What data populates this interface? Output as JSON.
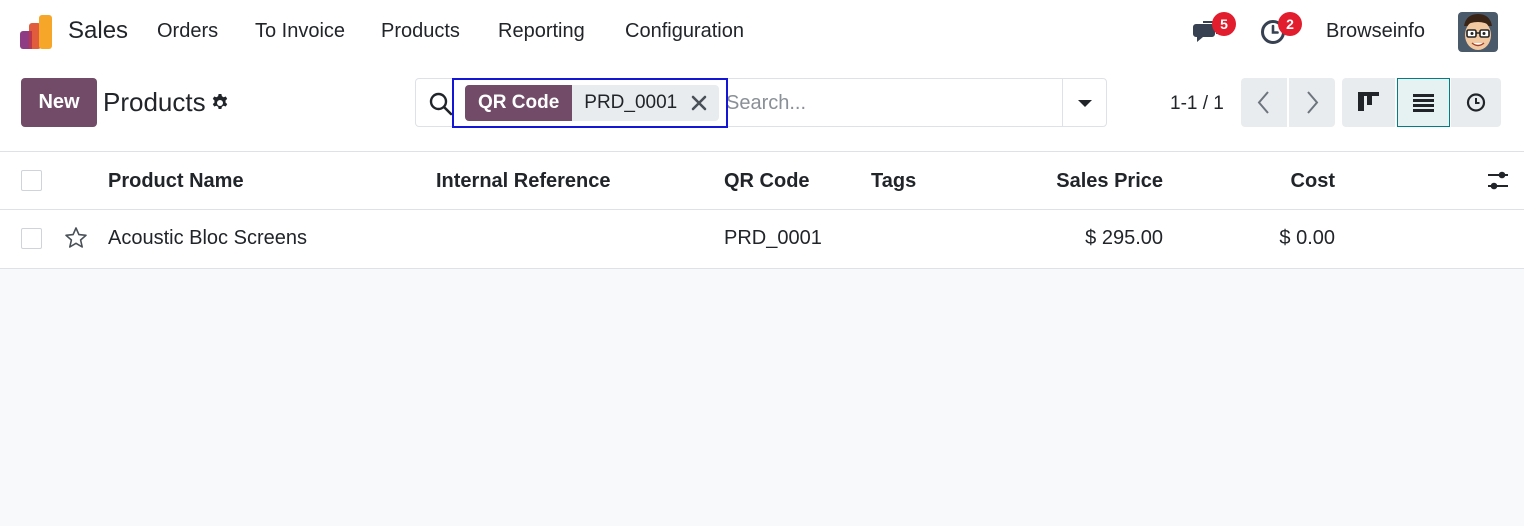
{
  "navbar": {
    "app_name": "Sales",
    "menus": [
      "Orders",
      "To Invoice",
      "Products",
      "Reporting",
      "Configuration"
    ],
    "messages_count": "5",
    "activities_count": "2",
    "user_name": "Browseinfo",
    "accent_color": "#714b67"
  },
  "control_panel": {
    "new_button": "New",
    "title": "Products",
    "search": {
      "facet_label": "QR Code",
      "facet_value": "PRD_0001",
      "placeholder": "Search..."
    },
    "pager": "1-1 / 1",
    "views": [
      "kanban",
      "list",
      "activity"
    ],
    "active_view": "list"
  },
  "table": {
    "columns": [
      "Product Name",
      "Internal Reference",
      "QR Code",
      "Tags",
      "Sales Price",
      "Cost"
    ],
    "rows": [
      {
        "product_name": "Acoustic Bloc Screens",
        "internal_reference": "",
        "qr_code": "PRD_0001",
        "tags": "",
        "sales_price": "$ 295.00",
        "cost": "$ 0.00"
      }
    ]
  }
}
